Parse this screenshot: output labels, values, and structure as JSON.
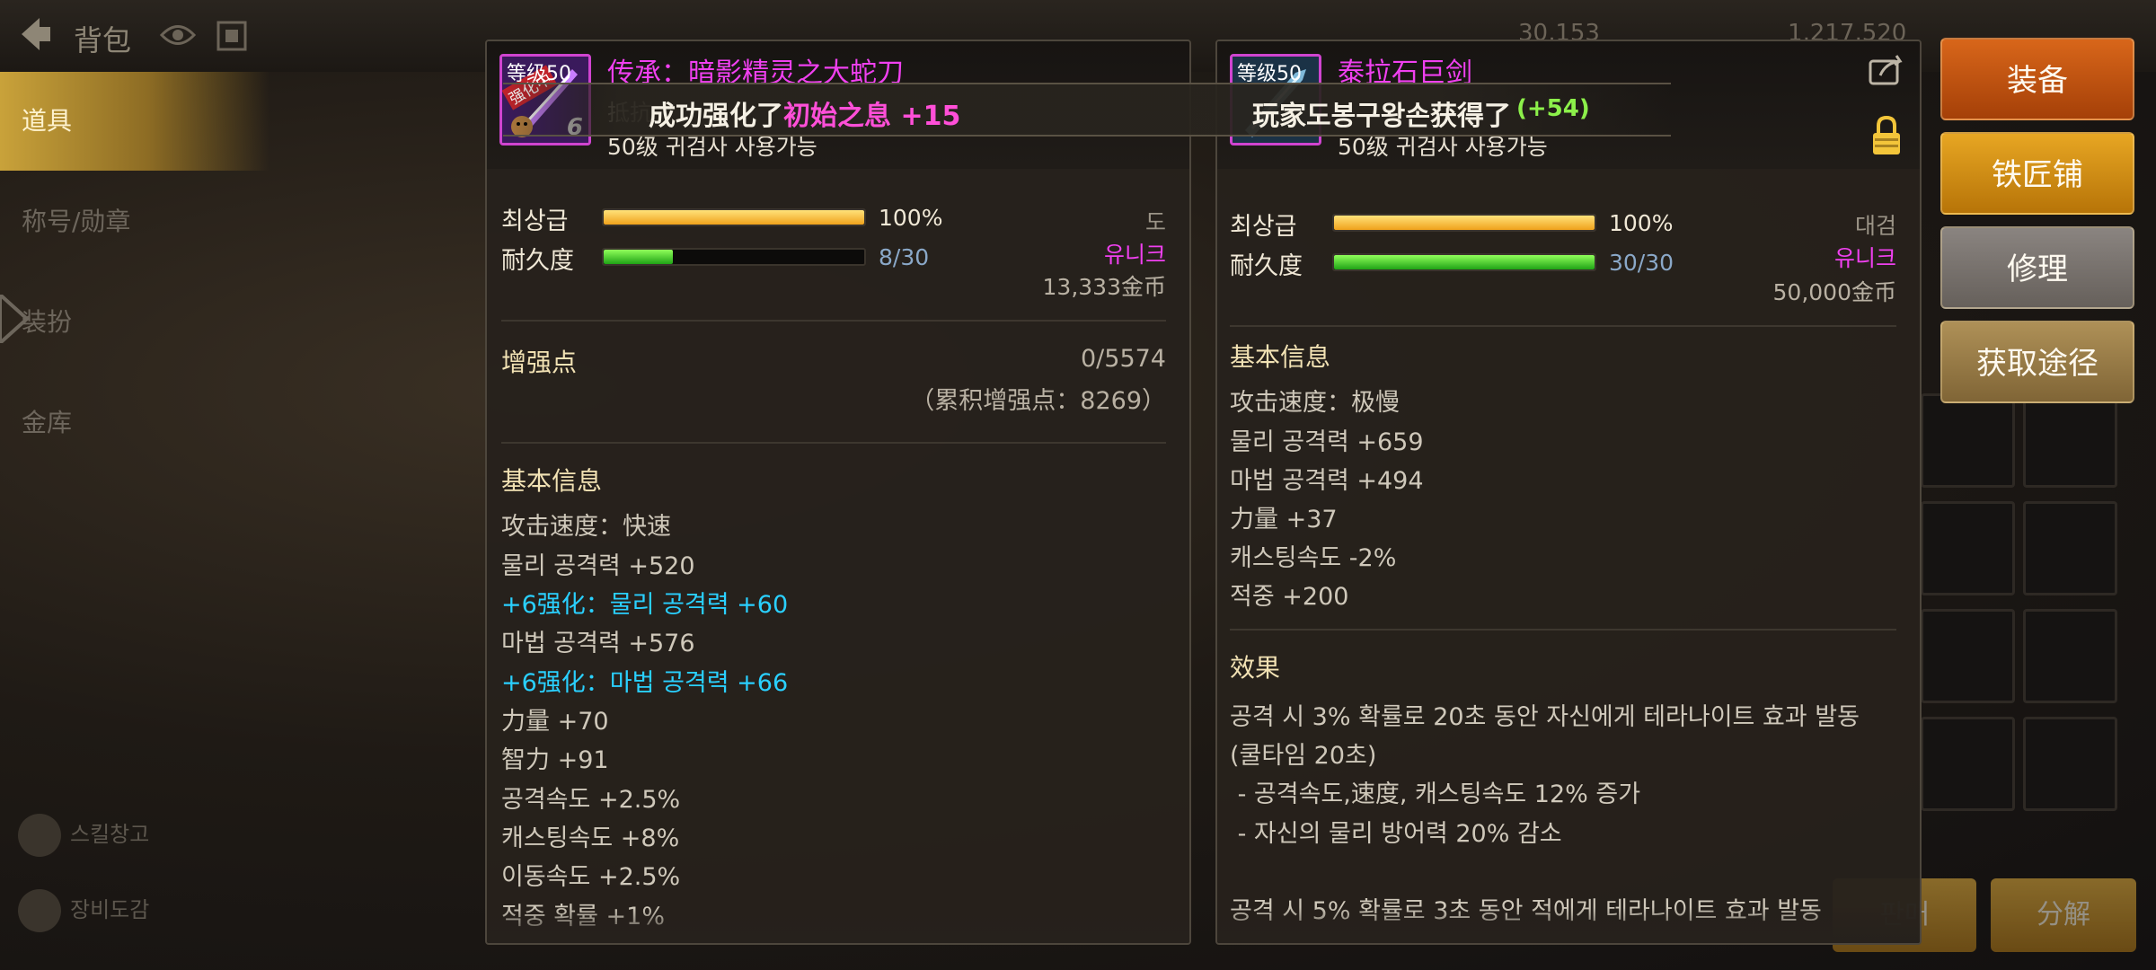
{
  "header": {
    "title": "背包",
    "gold_partial_1": "30,153",
    "gold_partial_2": "1,217,520"
  },
  "sidebar": {
    "items": [
      {
        "label": "道具"
      },
      {
        "label": "称号/勋章"
      },
      {
        "label": "装扮"
      },
      {
        "label": "金库"
      }
    ],
    "bottom": [
      {
        "label": "스킬창고"
      },
      {
        "label": "장비도감"
      }
    ]
  },
  "toast": {
    "prefix": "成功强化了",
    "item": "初始之息",
    "suffix": " +15",
    "prefix2": "玩家도봉구왕손获得了",
    "plus": "(+54)"
  },
  "left_item": {
    "level_tag": "等级50",
    "upgrading_tag": "强化中",
    "enhance_badge": "6",
    "name": "传承：暗影精灵之大蛇刀",
    "sub": "抵抗",
    "req": "50级 귀검사 사용가능",
    "grade_label": "최상급",
    "grade_value": "100%",
    "grade_pct": 1.0,
    "durability_label": "耐久度",
    "durability_value": "8/30",
    "durability_pct": 0.2667,
    "weapon_type": "도",
    "rarity": "유니크",
    "price": "13,333金币",
    "enhance_title": "增强点",
    "enhance_value": "0/5574",
    "enhance_total": "（累积增强点：8269）",
    "basic_title": "基本信息",
    "stats": [
      {
        "text": "攻击速度：快速",
        "color": "normal"
      },
      {
        "text": "물리 공격력 +520",
        "color": "normal"
      },
      {
        "text": "+6强化：물리 공격력 +60",
        "color": "cyan"
      },
      {
        "text": "마법 공격력 +576",
        "color": "normal"
      },
      {
        "text": "+6强化：마법 공격력 +66",
        "color": "cyan"
      },
      {
        "text": "力量 +70",
        "color": "normal"
      },
      {
        "text": "智力 +91",
        "color": "normal"
      },
      {
        "text": "공격속도 +2.5%",
        "color": "normal"
      },
      {
        "text": "캐스팅속도 +8%",
        "color": "normal"
      },
      {
        "text": "이동속도 +2.5%",
        "color": "normal"
      },
      {
        "text": "적중 확률 +1%",
        "color": "normal"
      }
    ]
  },
  "right_item": {
    "level_tag": "等级50",
    "name": "泰拉石巨剑",
    "req": "50级 귀검사 사용가능",
    "grade_label": "최상급",
    "grade_value": "100%",
    "grade_pct": 1.0,
    "durability_label": "耐久度",
    "durability_value": "30/30",
    "durability_pct": 1.0,
    "weapon_type": "대검",
    "rarity": "유니크",
    "price": "50,000金币",
    "basic_title": "基本信息",
    "stats": [
      "攻击速度：极慢",
      "물리 공격력 +659",
      "마법 공격력 +494",
      "力量 +37",
      "캐스팅속도 -2%",
      "적중 +200"
    ],
    "effect_title": "效果",
    "effects": [
      "공격 시 3% 확률로 20초 동안 자신에게 테라나이트 효과 발동",
      "(쿨타임 20초)",
      " - 공격속도,速度, 캐스팅속도 12% 증가",
      " - 자신의 물리 방어력 20% 감소",
      "",
      "공격 시 5% 확률로 3초 동안 적에게 테라나이트 효과 발동"
    ]
  },
  "actions": {
    "equip": "装备",
    "smith": "铁匠铺",
    "repair": "修理",
    "source": "获取途径"
  },
  "bottom_buttons": {
    "b1": "판매",
    "b2": "分解"
  },
  "colors": {
    "legendary": "#f040f0",
    "enhance": "#2ad0ff",
    "gold": "#f0a21c",
    "green": "#1fa316"
  }
}
